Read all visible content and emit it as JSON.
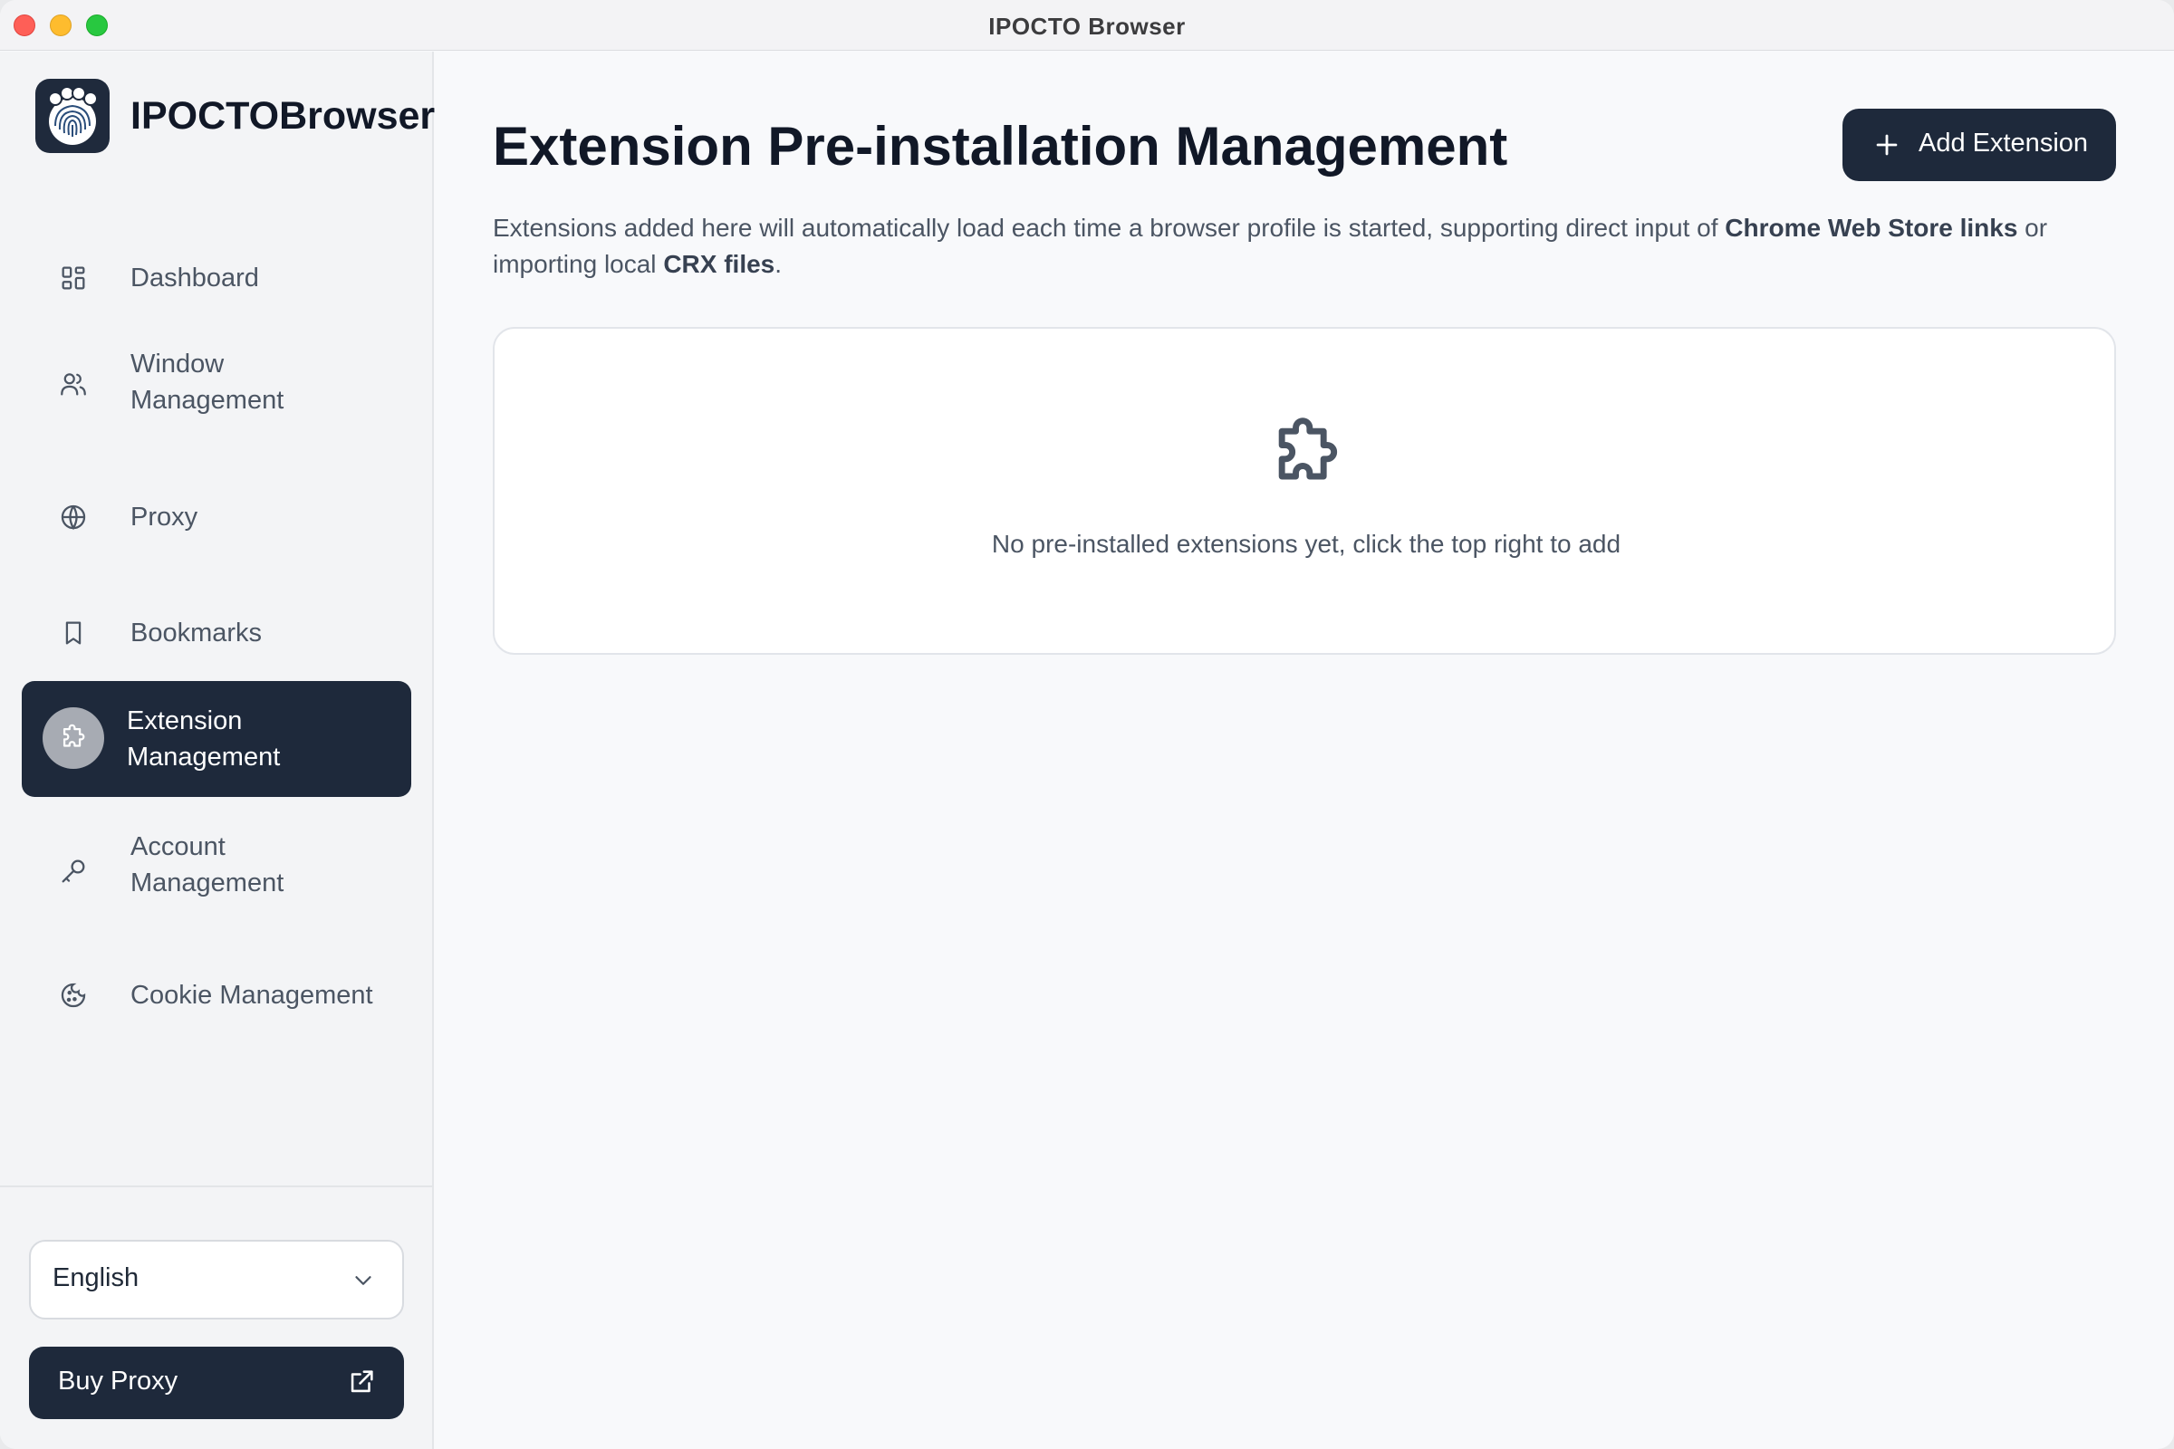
{
  "window": {
    "title": "IPOCTO Browser"
  },
  "brand": {
    "name": "IPOCTOBrowser"
  },
  "sidebar": {
    "items": [
      {
        "label": "Dashboard",
        "icon": "dashboard-icon"
      },
      {
        "label": "Window\nManagement",
        "icon": "users-icon"
      },
      {
        "label": "Proxy",
        "icon": "globe-icon"
      },
      {
        "label": "Bookmarks",
        "icon": "bookmark-icon"
      },
      {
        "label": "Extension\nManagement",
        "icon": "puzzle-icon",
        "active": true
      },
      {
        "label": "Account\nManagement",
        "icon": "key-icon"
      },
      {
        "label": "Cookie Management",
        "icon": "cookie-icon"
      }
    ],
    "language": {
      "selected": "English"
    },
    "buy_proxy": {
      "label": "Buy Proxy"
    }
  },
  "main": {
    "title": "Extension Pre-installation Management",
    "add_button": "Add Extension",
    "description": {
      "part1": "Extensions added here will automatically load each time a browser profile is started, supporting direct input of ",
      "bold1": "Chrome Web Store links",
      "part2": " or importing local ",
      "bold2": "CRX files",
      "part3": "."
    },
    "empty_state": "No pre-installed extensions yet, click the top right to add"
  },
  "colors": {
    "primary": "#1e293b",
    "sidebar_bg": "#f3f4f6",
    "main_bg": "#f8f9fb",
    "text_muted": "#4b5563"
  }
}
